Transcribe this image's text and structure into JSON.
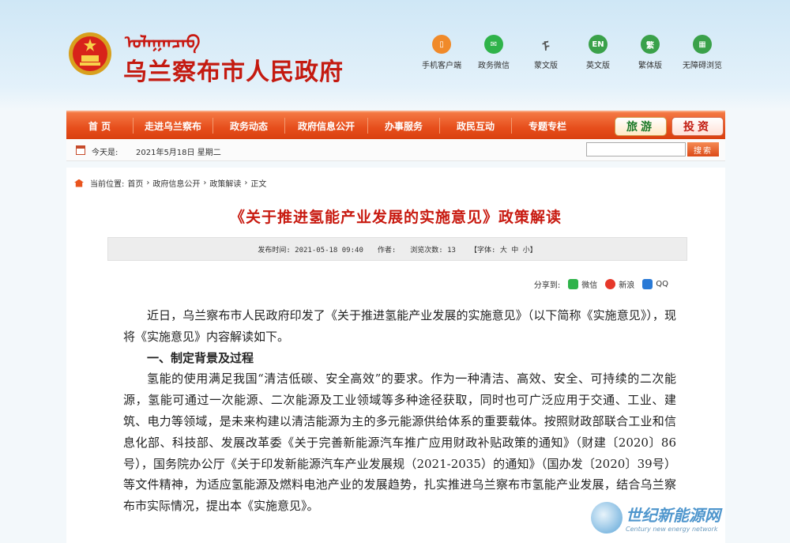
{
  "header": {
    "mongol_script": "ᠤᠯᠠᠭᠠᠨᠴᠠᠪ",
    "site_title": "乌兰察布市人民政府",
    "tools": [
      {
        "label": "手机客户端",
        "icon": "mobile-icon",
        "color": "#f08a2a",
        "glyph": "▯"
      },
      {
        "label": "政务微信",
        "icon": "wechat-icon",
        "color": "#2fb34a",
        "glyph": "✉"
      },
      {
        "label": "蒙文版",
        "icon": "mongolian-icon",
        "color": "#555555",
        "glyph": "ᠮ"
      },
      {
        "label": "英文版",
        "icon": "english-icon",
        "color": "#3aa14a",
        "glyph": "EN"
      },
      {
        "label": "繁体版",
        "icon": "traditional-icon",
        "color": "#3aa14a",
        "glyph": "繁"
      },
      {
        "label": "无障碍浏览",
        "icon": "accessibility-icon",
        "color": "#3aa14a",
        "glyph": "▦"
      }
    ]
  },
  "nav": {
    "items": [
      "首 页",
      "走进乌兰察布",
      "政务动态",
      "政府信息公开",
      "办事服务",
      "政民互动",
      "专题专栏"
    ],
    "travel_label": "旅游",
    "invest_label": "投资"
  },
  "strip": {
    "today_label": "今天是:",
    "date": "2021年5月18日 星期二",
    "search_label": "搜索"
  },
  "breadcrumb": {
    "prefix": "当前位置:",
    "items": [
      "首页",
      "政府信息公开",
      "政策解读",
      "正文"
    ],
    "sep": "›"
  },
  "article": {
    "title": "《关于推进氢能产业发展的实施意见》政策解读",
    "meta": {
      "publish": "发布时间: 2021-05-18 09:40",
      "author": "作者:",
      "views": "浏览次数: 13",
      "font": "【字体: 大 中 小】"
    },
    "share": {
      "label": "分享到:",
      "items": [
        {
          "label": "微信",
          "icon": "wechat-share-icon",
          "color": "#2fb34a"
        },
        {
          "label": "新浪",
          "icon": "weibo-share-icon",
          "color": "#e6382a"
        },
        {
          "label": "QQ",
          "icon": "qq-share-icon",
          "color": "#2a7ad6"
        }
      ]
    },
    "p1": "近日，乌兰察布市人民政府印发了《关于推进氢能产业发展的实施意见》（以下简称《实施意见》），现将《实施意见》内容解读如下。",
    "h1": "一、制定背景及过程",
    "p2": "氢能的使用满足我国“清洁低碳、安全高效”的要求。作为一种清洁、高效、安全、可持续的二次能源，氢能可通过一次能源、二次能源及工业领域等多种途径获取，同时也可广泛应用于交通、工业、建筑、电力等领域，是未来构建以清洁能源为主的多元能源供给体系的重要载体。按照财政部联合工业和信息化部、科技部、发展改革委《关于完善新能源汽车推广应用财政补贴政策的通知》（财建〔2020〕86号），国务院办公厅《关于印发新能源汽车产业发展规（2021-2035）的通知》（国办发〔2020〕39号）等文件精神，为适应氢能源及燃料电池产业的发展趋势，扎实推进乌兰察布市氢能产业发展，结合乌兰察布市实际情况，提出本《实施意见》。"
  },
  "watermark": {
    "cn": "世纪新能源网",
    "en": "Century new energy network"
  }
}
